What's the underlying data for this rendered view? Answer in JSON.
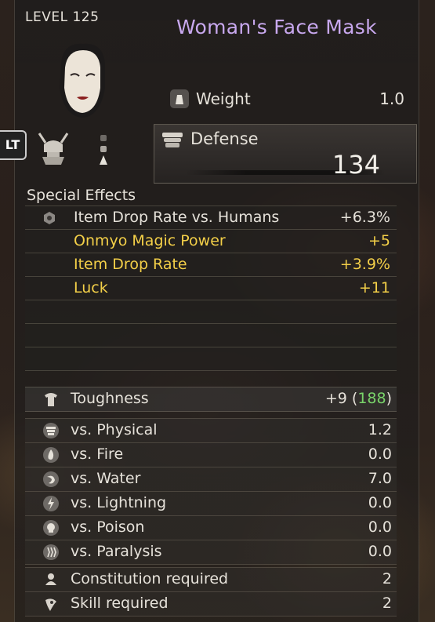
{
  "header": {
    "level": "LEVEL 125",
    "item_name": "Woman's Face Mask",
    "lt_button": "LT"
  },
  "weight": {
    "label": "Weight",
    "value": "1.0"
  },
  "defense": {
    "label": "Defense",
    "value": "134"
  },
  "special_effects": {
    "title": "Special Effects",
    "rows": [
      {
        "label": "Item Drop Rate vs. Humans",
        "value": "+6.3%",
        "color": "#e6e2da"
      },
      {
        "label": "Onmyo Magic Power",
        "value": "+5",
        "color": "#f3cf48"
      },
      {
        "label": "Item Drop Rate",
        "value": "+3.9%",
        "color": "#f3cf48"
      },
      {
        "label": "Luck",
        "value": "+11",
        "color": "#f3cf48"
      },
      {
        "label": "",
        "value": ""
      },
      {
        "label": "",
        "value": ""
      },
      {
        "label": "",
        "value": ""
      }
    ]
  },
  "toughness": {
    "label": "Toughness",
    "value": "+9",
    "open": "(",
    "total": "188",
    "close": ")",
    "total_color": "#79d36a"
  },
  "resistances": [
    {
      "label": "vs. Physical",
      "value": "1.2",
      "icon": "physical-icon"
    },
    {
      "label": "vs. Fire",
      "value": "0.0",
      "icon": "fire-icon"
    },
    {
      "label": "vs. Water",
      "value": "7.0",
      "icon": "water-icon"
    },
    {
      "label": "vs. Lightning",
      "value": "0.0",
      "icon": "lightning-icon"
    },
    {
      "label": "vs. Poison",
      "value": "0.0",
      "icon": "poison-icon"
    },
    {
      "label": "vs. Paralysis",
      "value": "0.0",
      "icon": "paralysis-icon"
    }
  ],
  "requirements": [
    {
      "label": "Constitution required",
      "value": "2",
      "icon": "constitution-icon"
    },
    {
      "label": "Skill required",
      "value": "2",
      "icon": "skill-icon"
    }
  ],
  "colors": {
    "title": "#c8a8ee",
    "gold": "#f3cf48",
    "green": "#79d36a"
  }
}
